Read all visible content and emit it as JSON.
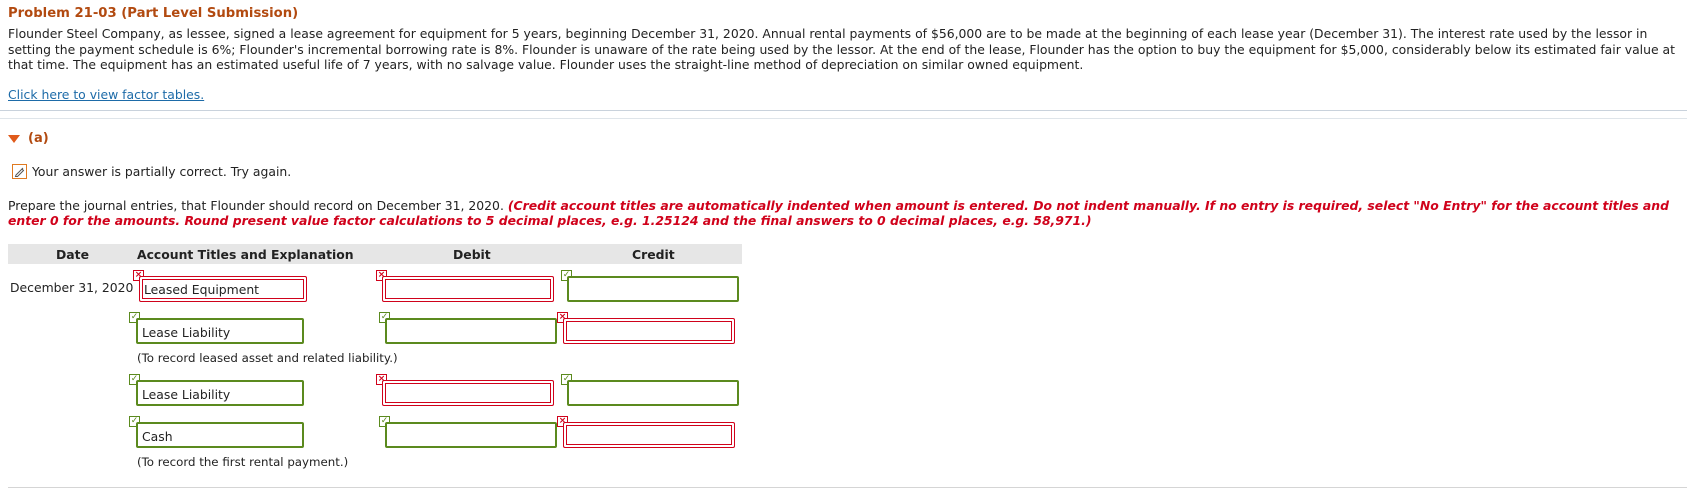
{
  "problem": {
    "title": "Problem 21-03 (Part Level Submission)",
    "description": "Flounder Steel Company, as lessee, signed a lease agreement for equipment for 5 years, beginning December 31, 2020. Annual rental payments of $56,000 are to be made at the beginning of each lease year (December 31). The interest rate used by the lessor in setting the payment schedule is 6%; Flounder's incremental borrowing rate is 8%. Flounder is unaware of the rate being used by the lessor. At the end of the lease, Flounder has the option to buy the equipment for $5,000, considerably below its estimated fair value at that time. The equipment has an estimated useful life of 7 years, with no salvage value. Flounder uses the straight-line method of depreciation on similar owned equipment.",
    "factor_link": "Click here to view factor tables."
  },
  "part": {
    "label": "(a)",
    "feedback": "Your answer is partially correct.  Try again.",
    "instruction_plain": "Prepare the journal entries, that Flounder should record on December 31, 2020. ",
    "instruction_red": "(Credit account titles are automatically indented when amount is entered. Do not indent manually. If no entry is required, select \"No Entry\" for the account titles and enter 0 for the amounts. Round present value factor calculations to 5 decimal places, e.g. 1.25124 and the final answers to 0 decimal places, e.g. 58,971.)"
  },
  "table": {
    "headers": {
      "date": "Date",
      "account": "Account Titles and Explanation",
      "debit": "Debit",
      "credit": "Credit"
    },
    "date": "December 31, 2020",
    "rows": [
      {
        "account": "Leased Equipment",
        "account_status": "incorrect",
        "debit": "",
        "debit_status": "incorrect",
        "credit": "",
        "credit_status": "correct"
      },
      {
        "account": "Lease Liability",
        "account_status": "correct",
        "debit": "",
        "debit_status": "correct",
        "credit": "",
        "credit_status": "incorrect"
      },
      {
        "account": "Lease Liability",
        "account_status": "correct",
        "debit": "",
        "debit_status": "incorrect",
        "credit": "",
        "credit_status": "correct"
      },
      {
        "account": "Cash",
        "account_status": "correct",
        "debit": "",
        "debit_status": "correct",
        "credit": "",
        "credit_status": "incorrect"
      }
    ],
    "notes": [
      "(To record leased asset and related liability.)",
      "(To record the first rental payment.)"
    ]
  },
  "colors": {
    "title": "#b24a10",
    "link": "#1d6ba8",
    "error": "#d0021b",
    "correct": "#5b8a1e"
  },
  "icons": {
    "correct": "check-icon",
    "incorrect": "x-icon",
    "feedback": "pencil-icon",
    "toggle": "triangle-down-icon"
  }
}
